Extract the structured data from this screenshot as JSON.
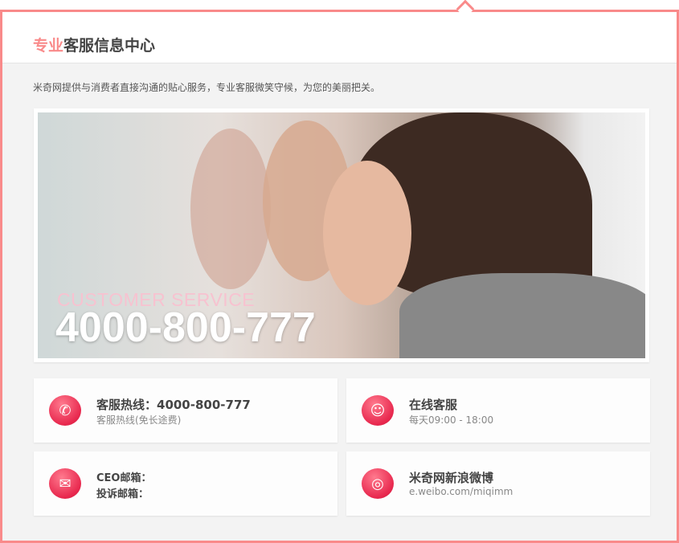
{
  "header": {
    "title_highlight": "专业",
    "title_rest": "客服信息中心"
  },
  "intro": "米奇网提供与消费者直接沟通的贴心服务，专业客服微笑守候，为您的美丽把关。",
  "banner": {
    "caption": "CUSTOMER SERVICE",
    "phone": "4000-800-777"
  },
  "cards": [
    {
      "icon": "phone-icon",
      "title": "客服热线：4000-800-777",
      "sub": "客服热线(免长途费)"
    },
    {
      "icon": "smiley-icon",
      "title": "在线客服",
      "sub": "每天09:00 - 18:00"
    },
    {
      "icon": "mail-icon",
      "line1": "CEO邮箱：",
      "line2": "投诉邮箱："
    },
    {
      "icon": "weibo-icon",
      "title": "米奇网新浪微博",
      "sub": "e.weibo.com/miqimm"
    }
  ],
  "colors": {
    "accent": "#f98a8a",
    "icon": "#e8284e"
  }
}
